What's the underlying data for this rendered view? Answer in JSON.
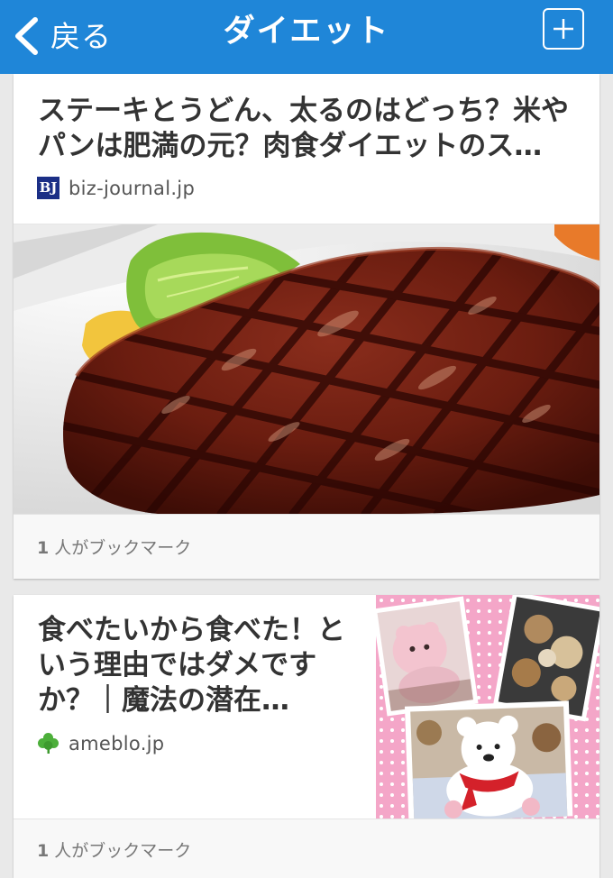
{
  "nav": {
    "back_label": "戻る",
    "title": "ダイエット",
    "accent_color": "#1f86d8"
  },
  "articles": [
    {
      "title": "ステーキとうどん、太るのはどっち？米やパンは肥満の元？肉食ダイエットのス…",
      "source": "biz-journal.jp",
      "source_icon": "bj-logo",
      "source_icon_text": "BJ",
      "image": "steak-photo",
      "bookmark_count": "1",
      "bookmark_label": "人がブックマーク"
    },
    {
      "title": "食べたいから食べた！という理由ではダメですか？｜魔法の潜在…",
      "source": "ameblo.jp",
      "source_icon": "ameblo-clover-logo",
      "image": "teddy-bears-collage",
      "bookmark_count": "1",
      "bookmark_label": "人がブックマーク"
    }
  ]
}
